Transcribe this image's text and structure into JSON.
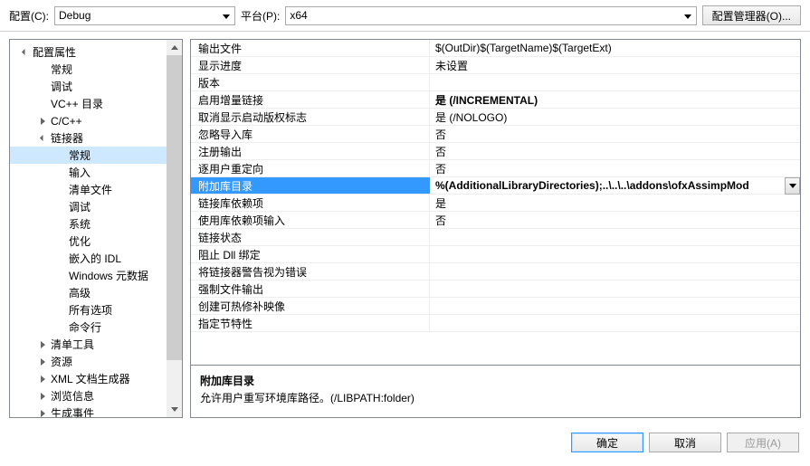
{
  "toolbar": {
    "config_label": "配置(C):",
    "config_value": "Debug",
    "platform_label": "平台(P):",
    "platform_value": "x64",
    "manager_label": "配置管理器(O)..."
  },
  "tree": [
    {
      "label": "配置属性",
      "depth": 1,
      "toggle": "open"
    },
    {
      "label": "常规",
      "depth": 2
    },
    {
      "label": "调试",
      "depth": 2
    },
    {
      "label": "VC++ 目录",
      "depth": 2
    },
    {
      "label": "C/C++",
      "depth": 2,
      "toggle": "closed"
    },
    {
      "label": "链接器",
      "depth": 2,
      "toggle": "open"
    },
    {
      "label": "常规",
      "depth": 3,
      "selected": true
    },
    {
      "label": "输入",
      "depth": 3
    },
    {
      "label": "清单文件",
      "depth": 3
    },
    {
      "label": "调试",
      "depth": 3
    },
    {
      "label": "系统",
      "depth": 3
    },
    {
      "label": "优化",
      "depth": 3
    },
    {
      "label": "嵌入的 IDL",
      "depth": 3
    },
    {
      "label": "Windows 元数据",
      "depth": 3
    },
    {
      "label": "高级",
      "depth": 3
    },
    {
      "label": "所有选项",
      "depth": 3
    },
    {
      "label": "命令行",
      "depth": 3
    },
    {
      "label": "清单工具",
      "depth": 2,
      "toggle": "closed"
    },
    {
      "label": "资源",
      "depth": 2,
      "toggle": "closed"
    },
    {
      "label": "XML 文档生成器",
      "depth": 2,
      "toggle": "closed"
    },
    {
      "label": "浏览信息",
      "depth": 2,
      "toggle": "closed"
    },
    {
      "label": "生成事件",
      "depth": 2,
      "toggle": "closed"
    }
  ],
  "grid": [
    {
      "key": "输出文件",
      "val": "$(OutDir)$(TargetName)$(TargetExt)"
    },
    {
      "key": "显示进度",
      "val": "未设置"
    },
    {
      "key": "版本",
      "val": ""
    },
    {
      "key": "启用增量链接",
      "val": "是 (/INCREMENTAL)",
      "bold": true
    },
    {
      "key": "取消显示启动版权标志",
      "val": "是 (/NOLOGO)"
    },
    {
      "key": "忽略导入库",
      "val": "否"
    },
    {
      "key": "注册输出",
      "val": "否"
    },
    {
      "key": "逐用户重定向",
      "val": "否"
    },
    {
      "key": "附加库目录",
      "val": "%(AdditionalLibraryDirectories);..\\..\\..\\addons\\ofxAssimpMod",
      "selected": true
    },
    {
      "key": "链接库依赖项",
      "val": "是"
    },
    {
      "key": "使用库依赖项输入",
      "val": "否"
    },
    {
      "key": "链接状态",
      "val": ""
    },
    {
      "key": "阻止 Dll 绑定",
      "val": ""
    },
    {
      "key": "将链接器警告视为错误",
      "val": ""
    },
    {
      "key": "强制文件输出",
      "val": ""
    },
    {
      "key": "创建可热修补映像",
      "val": ""
    },
    {
      "key": "指定节特性",
      "val": ""
    }
  ],
  "description": {
    "title": "附加库目录",
    "body": "允许用户重写环境库路径。(/LIBPATH:folder)"
  },
  "footer": {
    "ok": "确定",
    "cancel": "取消",
    "apply": "应用(A)"
  }
}
